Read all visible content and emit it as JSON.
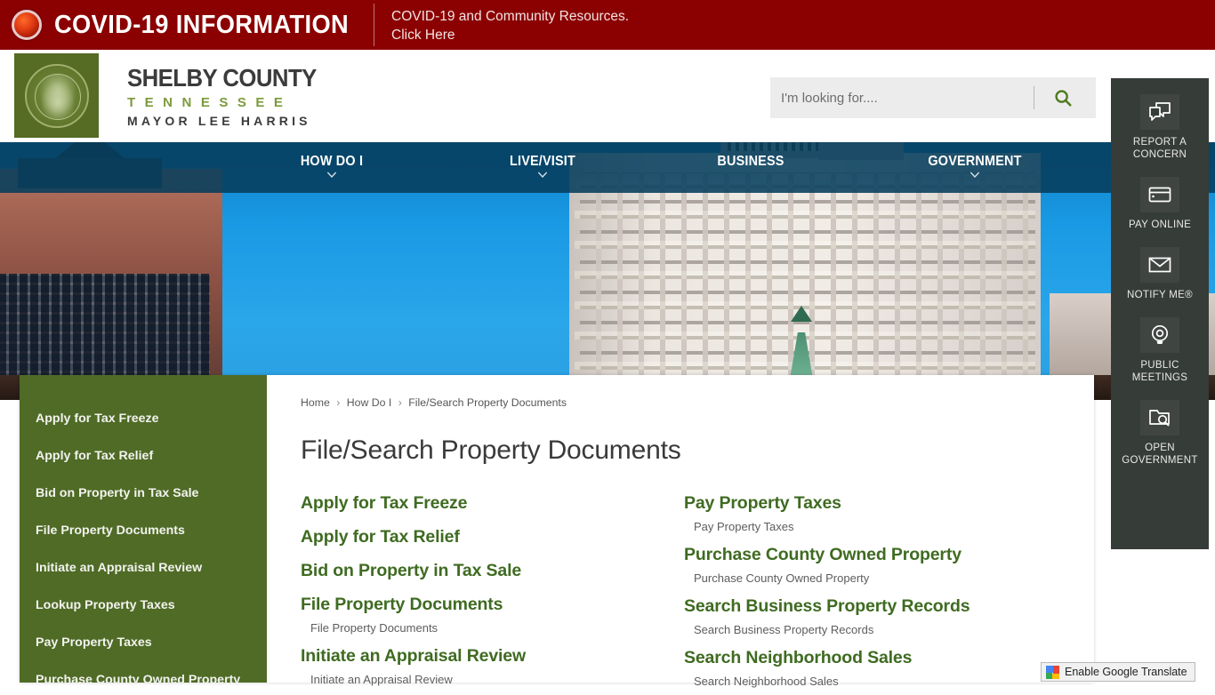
{
  "covid_banner": {
    "title": "COVID-19 INFORMATION",
    "subtitle_line1": "COVID-19 and Community Resources.",
    "subtitle_line2": "Click Here",
    "background_color": "#8b0000",
    "dot_icon": "alert-circle-icon"
  },
  "header": {
    "seal_icon": "shelby-county-seal-icon",
    "wordmark_line1": "SHELBY COUNTY",
    "wordmark_line2": "TENNESSEE",
    "wordmark_line3": "MAYOR LEE HARRIS",
    "brand_green": "#7d9a3c",
    "seal_block_color": "#566b24"
  },
  "search": {
    "value": "",
    "placeholder": "I'm looking for....",
    "button_icon": "search-icon",
    "icon_color": "#4f7a1f"
  },
  "nav": {
    "background_color": "#063e5c",
    "items": [
      {
        "label": "HOW DO I",
        "has_dropdown": true
      },
      {
        "label": "LIVE/VISIT",
        "has_dropdown": true
      },
      {
        "label": "BUSINESS",
        "has_dropdown": false
      },
      {
        "label": "GOVERNMENT",
        "has_dropdown": true
      }
    ]
  },
  "quick_bar": {
    "background_color": "#363c38",
    "items": [
      {
        "label_line1": "REPORT A",
        "label_line2": "CONCERN",
        "icon": "speech-bubbles-icon"
      },
      {
        "label_line1": "PAY ONLINE",
        "label_line2": "",
        "icon": "credit-card-icon"
      },
      {
        "label_line1": "NOTIFY ME®",
        "label_line2": "",
        "icon": "envelope-icon"
      },
      {
        "label_line1": "PUBLIC",
        "label_line2": "MEETINGS",
        "icon": "webcam-icon"
      },
      {
        "label_line1": "OPEN",
        "label_line2": "GOVERNMENT",
        "icon": "folder-search-icon"
      }
    ]
  },
  "side_menu": {
    "background_color": "#4f6b26",
    "items": [
      "Apply for Tax Freeze",
      "Apply for Tax Relief",
      "Bid on Property in Tax Sale",
      "File Property Documents",
      "Initiate an Appraisal Review",
      "Lookup Property Taxes",
      "Pay Property Taxes",
      "Purchase County Owned Property"
    ]
  },
  "breadcrumb": {
    "items": [
      "Home",
      "How Do I",
      "File/Search Property Documents"
    ],
    "separator": "›"
  },
  "page": {
    "title": "File/Search Property Documents",
    "link_color": "#3f6b21"
  },
  "link_columns": [
    {
      "groups": [
        {
          "title": "Apply for Tax Freeze",
          "description": ""
        },
        {
          "title": "Apply for Tax Relief",
          "description": ""
        },
        {
          "title": "Bid on Property in Tax Sale",
          "description": ""
        },
        {
          "title": "File Property Documents",
          "description": "File Property Documents"
        },
        {
          "title": "Initiate an Appraisal Review",
          "description": "Initiate an Appraisal Review"
        }
      ]
    },
    {
      "groups": [
        {
          "title": "Pay Property Taxes",
          "description": "Pay Property Taxes"
        },
        {
          "title": "Purchase County Owned Property",
          "description": "Purchase County Owned Property"
        },
        {
          "title": "Search Business Property Records",
          "description": "Search Business Property Records"
        },
        {
          "title": "Search Neighborhood Sales",
          "description": "Search Neighborhood Sales"
        }
      ]
    }
  ],
  "translate": {
    "label": "Enable Google Translate",
    "icon": "google-translate-icon"
  }
}
